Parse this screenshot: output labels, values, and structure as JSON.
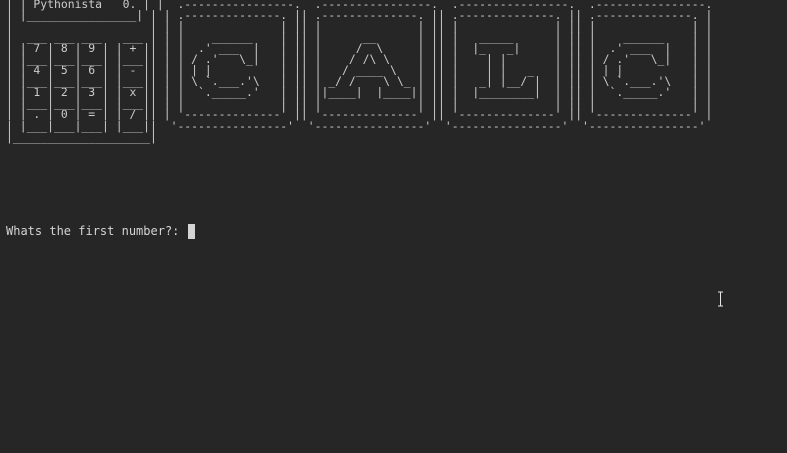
{
  "terminal": {
    "banner_lines": [
      "| | Pythonista   0. | |  .----------------.  .----------------.  .----------------.  .----------------.",
      "| |________________| | | .--------------. || .--------------. || .--------------. || .--------------. |",
      "|                    | | |              | || |              | || |              | || |              | |",
      "|  ___ ___ ___   ___ | | |    ______    | || |      __      | || |   _____      | || |    ______    | |",
      "| | 7 | 8 | 9 | | + || | |  .' ___  |   | || |     /  \\     | || |  |_   _|     | || |  .' ___  |   | |",
      "| |___|___|___| |___|| | | / .'   \\_|   | || |    / /\\ \\    | || |    | |       | || | / .'   \\_|   | |",
      "| | 4 | 5 | 6 | | - || | | | |          | || |   / ____ \\   | || |    | |   _   | || | | |          | |",
      "| |___|___|___| |___|| | | \\ `.___.'\\   | || | _/ /    \\ \\_ | || |   _| |__/ |  | || | \\ `.___.'\\   | |",
      "| | 1 | 2 | 3 | | x || | |  `._____.'   | || ||____|  |____|| || |  |________|  | || |  `._____.'   | |",
      "| |___|___|___| |___|| | |              | || |              | || |              | || |              | |",
      "| | . | 0 | = | | / || | '--------------' || '--------------' || '--------------' || '--------------' |",
      "| |___|___|___| |___||  '----------------'  '----------------'  '----------------'  '----------------'",
      "|____________________|",
      ""
    ],
    "prompt_text": "Whats the first number?: ",
    "input_value": ""
  }
}
